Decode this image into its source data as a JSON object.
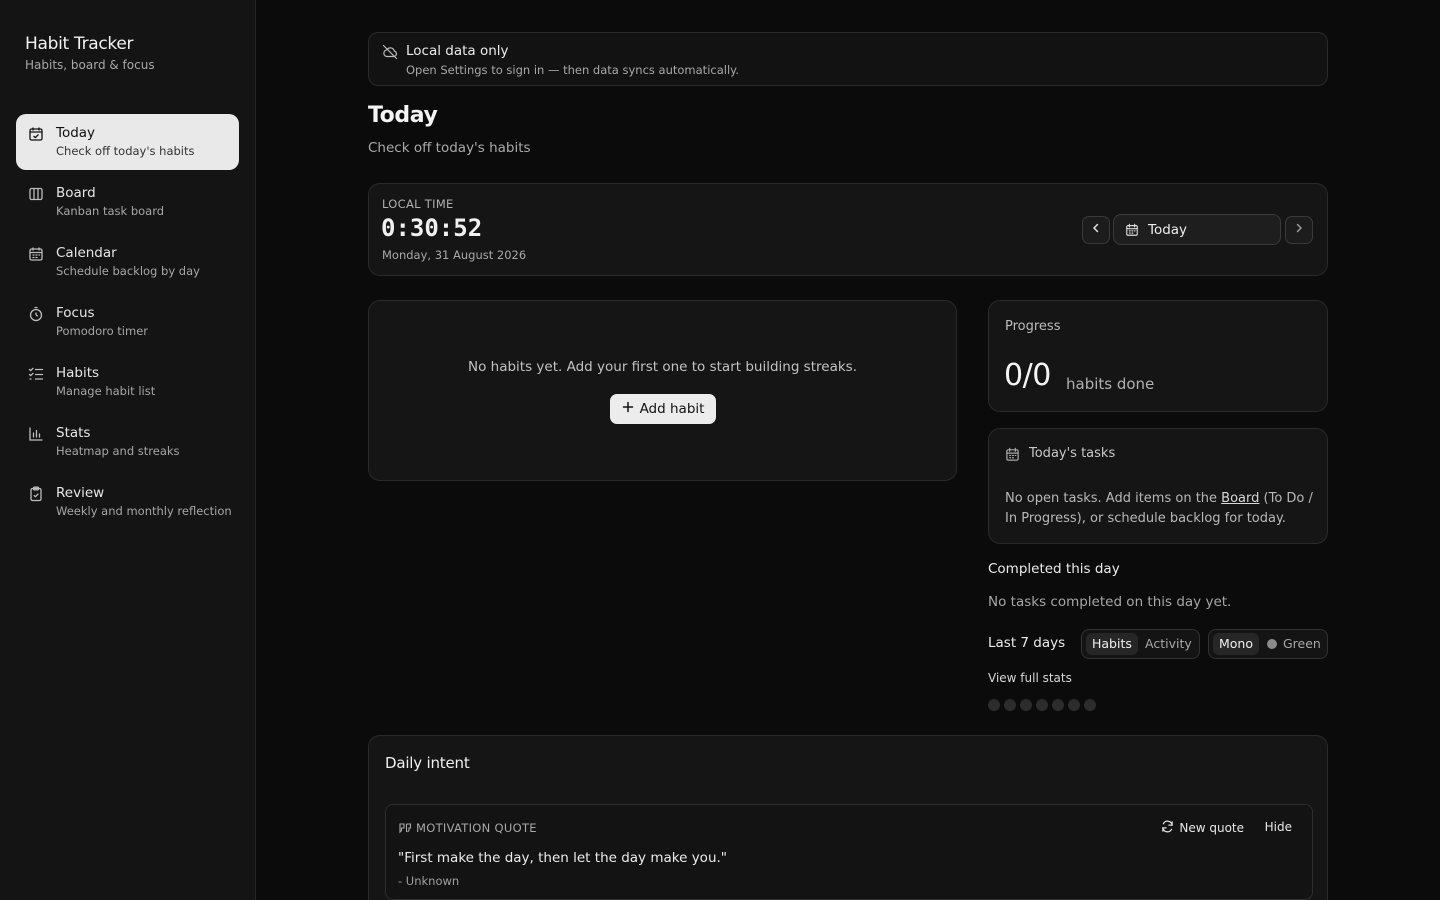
{
  "colors": {
    "background": "#0b0b0b",
    "sidebar": "#141414",
    "card": "#151515",
    "active_nav": "#e9e9e9",
    "border": "#2a2a2a"
  },
  "brand": {
    "title": "Habit Tracker",
    "subtitle": "Habits, board & focus"
  },
  "sidebar": {
    "items": [
      {
        "label": "Today",
        "sub": "Check off today's habits",
        "icon": "calendar-check-icon",
        "active": true
      },
      {
        "label": "Board",
        "sub": "Kanban task board",
        "icon": "kanban-columns-icon",
        "active": false
      },
      {
        "label": "Calendar",
        "sub": "Schedule backlog by day",
        "icon": "calendar-icon",
        "active": false
      },
      {
        "label": "Focus",
        "sub": "Pomodoro timer",
        "icon": "timer-icon",
        "active": false
      },
      {
        "label": "Habits",
        "sub": "Manage habit list",
        "icon": "checklist-icon",
        "active": false
      },
      {
        "label": "Stats",
        "sub": "Heatmap and streaks",
        "icon": "bar-chart-icon",
        "active": false
      },
      {
        "label": "Review",
        "sub": "Weekly and monthly reflection",
        "icon": "clipboard-check-icon",
        "active": false
      }
    ]
  },
  "banner": {
    "title": "Local data only",
    "subtitle": "Open Settings to sign in — then data syncs automatically.",
    "icon": "cloud-off-icon"
  },
  "page": {
    "title": "Today",
    "subtitle": "Check off today's habits"
  },
  "clock": {
    "label": "LOCAL TIME",
    "time": "0:30:52",
    "date": "Monday, 31 August 2026",
    "today_button": "Today"
  },
  "habits": {
    "empty": "No habits yet. Add your first one to start building streaks.",
    "add_button": "Add habit"
  },
  "progress": {
    "title": "Progress",
    "count": "0/0",
    "label": "habits done"
  },
  "tasks": {
    "title": "Today's tasks",
    "body_before": "No open tasks. Add items on the ",
    "link": "Board",
    "body_after": " (To Do / In Progress), or schedule backlog for today."
  },
  "completed": {
    "title": "Completed this day",
    "empty": "No tasks completed on this day yet."
  },
  "last7": {
    "title": "Last 7 days",
    "view_tabs": [
      {
        "label": "Habits",
        "selected": true
      },
      {
        "label": "Activity",
        "selected": false
      }
    ],
    "color_tabs": [
      {
        "label": "Mono",
        "selected": true
      },
      {
        "label": "Green",
        "selected": false
      }
    ],
    "view_full": "View full stats",
    "days_count": 7
  },
  "intent": {
    "title": "Daily intent",
    "quote_label": "MOTIVATION QUOTE",
    "new_quote": "New quote",
    "hide": "Hide",
    "quote": "\"First make the day, then let the day make you.\"",
    "author": "- Unknown"
  }
}
